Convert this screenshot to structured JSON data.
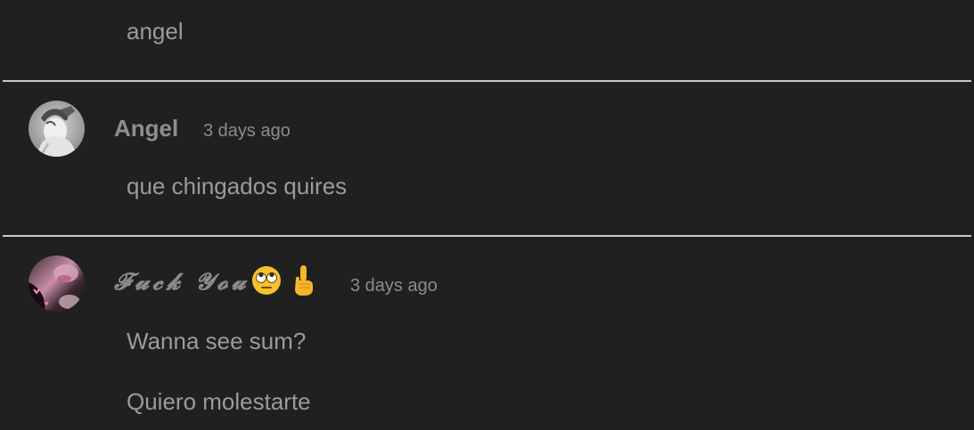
{
  "top_message": {
    "text": "angel"
  },
  "comments": [
    {
      "username": "Angel",
      "timestamp": "3 days ago",
      "messages": [
        "que chingados quires"
      ],
      "avatar_icon": "grayscale-person-avatar"
    },
    {
      "username": "𝓕𝓾𝓬𝓴 𝓨𝓸𝓾",
      "username_emojis": [
        "face-with-rolling-eyes-emoji",
        "middle-finger-emoji"
      ],
      "timestamp": "3 days ago",
      "messages": [
        "Wanna see sum?",
        "Quiero molestarte"
      ],
      "avatar_icon": "pink-dark-photo-avatar"
    }
  ],
  "colors": {
    "background": "#202020",
    "divider": "#c9c9c9",
    "text": "#9b9b9b"
  }
}
